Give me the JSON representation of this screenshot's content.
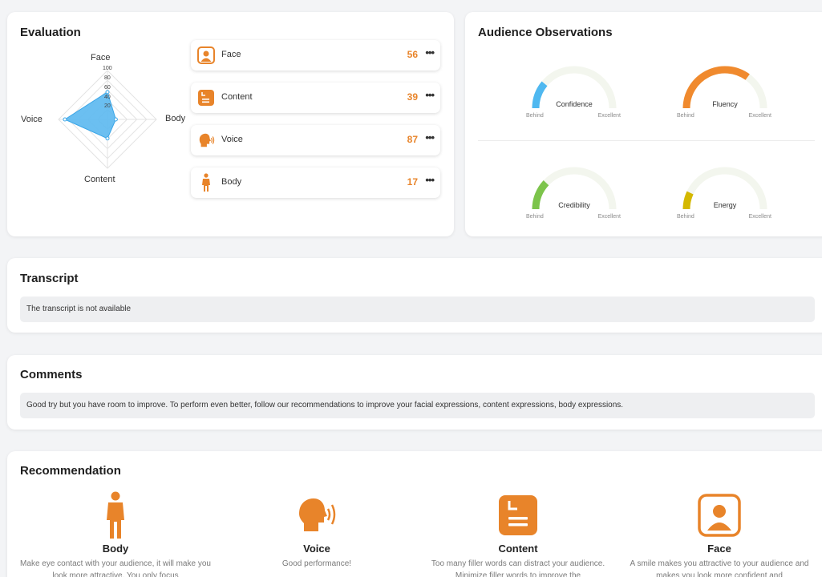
{
  "evaluation": {
    "title": "Evaluation",
    "radar": {
      "axes": [
        "Face",
        "Body",
        "Content",
        "Voice"
      ],
      "ticks": [
        "100",
        "80",
        "60",
        "40",
        "20"
      ],
      "values": {
        "face": 56,
        "body": 17,
        "content": 39,
        "voice": 87
      },
      "fill_color": "#5bb8ef"
    },
    "metrics": [
      {
        "label": "Face",
        "score": "56",
        "more": "•••",
        "icon": "face-icon"
      },
      {
        "label": "Content",
        "score": "39",
        "more": "•••",
        "icon": "content-icon"
      },
      {
        "label": "Voice",
        "score": "87",
        "more": "•••",
        "icon": "voice-icon"
      },
      {
        "label": "Body",
        "score": "17",
        "more": "•••",
        "icon": "body-icon"
      }
    ]
  },
  "audience": {
    "title": "Audience Observations",
    "scale_low": "Behind",
    "scale_high": "Excellent",
    "gauges": [
      {
        "name": "Confidence",
        "level": 0.22,
        "color": "#4fb8f0"
      },
      {
        "name": "Fluency",
        "level": 0.7,
        "color": "#f08a2e"
      },
      {
        "name": "Credibility",
        "level": 0.24,
        "color": "#7cc44b"
      },
      {
        "name": "Energy",
        "level": 0.14,
        "color": "#d4b800"
      }
    ]
  },
  "transcript": {
    "title": "Transcript",
    "text": "The transcript is not available"
  },
  "comments": {
    "title": "Comments",
    "text": "Good try but you have room to improve. To perform even better, follow our recommendations to improve your facial expressions, content expressions, body expressions."
  },
  "recommendation": {
    "title": "Recommendation",
    "items": [
      {
        "name": "Body",
        "text": "Make eye contact with your audience, it will make you look more attractive. You only focus",
        "icon": "body-icon"
      },
      {
        "name": "Voice",
        "text": "Good performance!",
        "icon": "voice-icon"
      },
      {
        "name": "Content",
        "text": "Too many filler words can distract your audience. Minimize filler words to improve the",
        "icon": "content-icon"
      },
      {
        "name": "Face",
        "text": "A smile makes you attractive to your audience and makes you look more confident and",
        "icon": "face-icon"
      }
    ]
  },
  "colors": {
    "accent": "#e8842a"
  }
}
